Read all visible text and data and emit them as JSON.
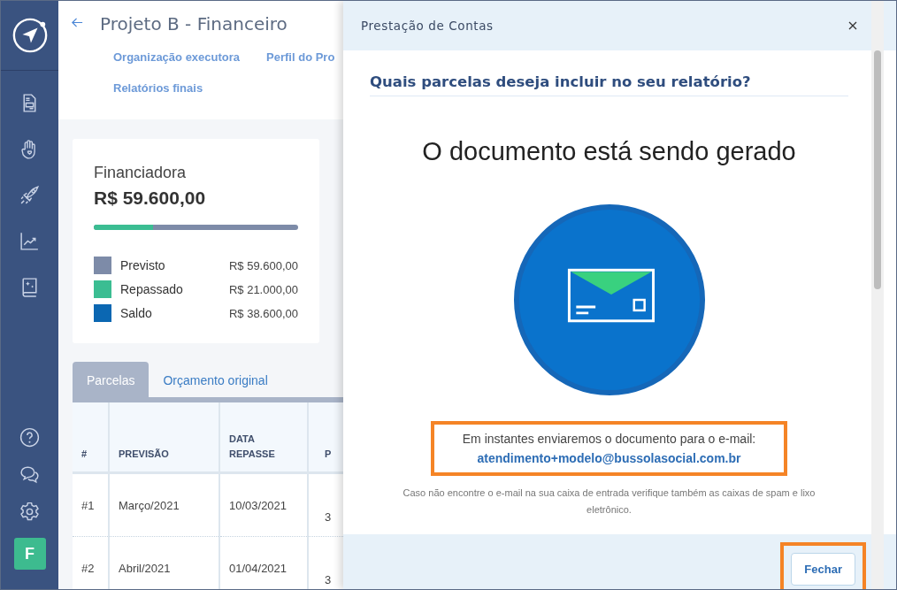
{
  "sidebar": {
    "avatar": "F"
  },
  "header": {
    "title": "Projeto B - Financeiro",
    "links": [
      {
        "label": "Organização executora"
      },
      {
        "label": "Perfil do Pro"
      },
      {
        "label": "Relatórios finais"
      }
    ]
  },
  "summary": {
    "title": "Financiadora",
    "total": "R$ 59.600,00",
    "level": 0.29,
    "legend": [
      {
        "label": "Previsto",
        "value": "R$ 59.600,00",
        "color": "#7d8ba8"
      },
      {
        "label": "Repassado",
        "value": "R$ 21.000,00",
        "color": "#3bbd92"
      },
      {
        "label": "Saldo",
        "value": "R$ 38.600,00",
        "color": "#0b67b2"
      }
    ]
  },
  "tabs": [
    {
      "label": "Parcelas",
      "selected": true
    },
    {
      "label": "Orçamento original",
      "selected": false
    }
  ],
  "table": {
    "columns": [
      "#",
      "PREVISÃO",
      "DATA REPASSE",
      "P"
    ],
    "rows": [
      [
        "#1",
        "Março/2021",
        "10/03/2021",
        "3"
      ],
      [
        "#2",
        "Abril/2021",
        "01/04/2021",
        "3"
      ]
    ]
  },
  "modal": {
    "title": "Prestação de Contas",
    "question": "Quais parcelas deseja incluir no seu relatório?",
    "heading": "O documento está sendo gerado",
    "message": "Em instantes enviaremos o documento para o e-mail:",
    "email": "atendimento+modelo@bussolasocial.com.br",
    "message_highlighted": true,
    "note": "Caso não encontre o e-mail na sua caixa de entrada verifique também as caixas de spam e lixo eletrônico.",
    "button": {
      "label": "Fechar",
      "highlighted": true
    }
  }
}
